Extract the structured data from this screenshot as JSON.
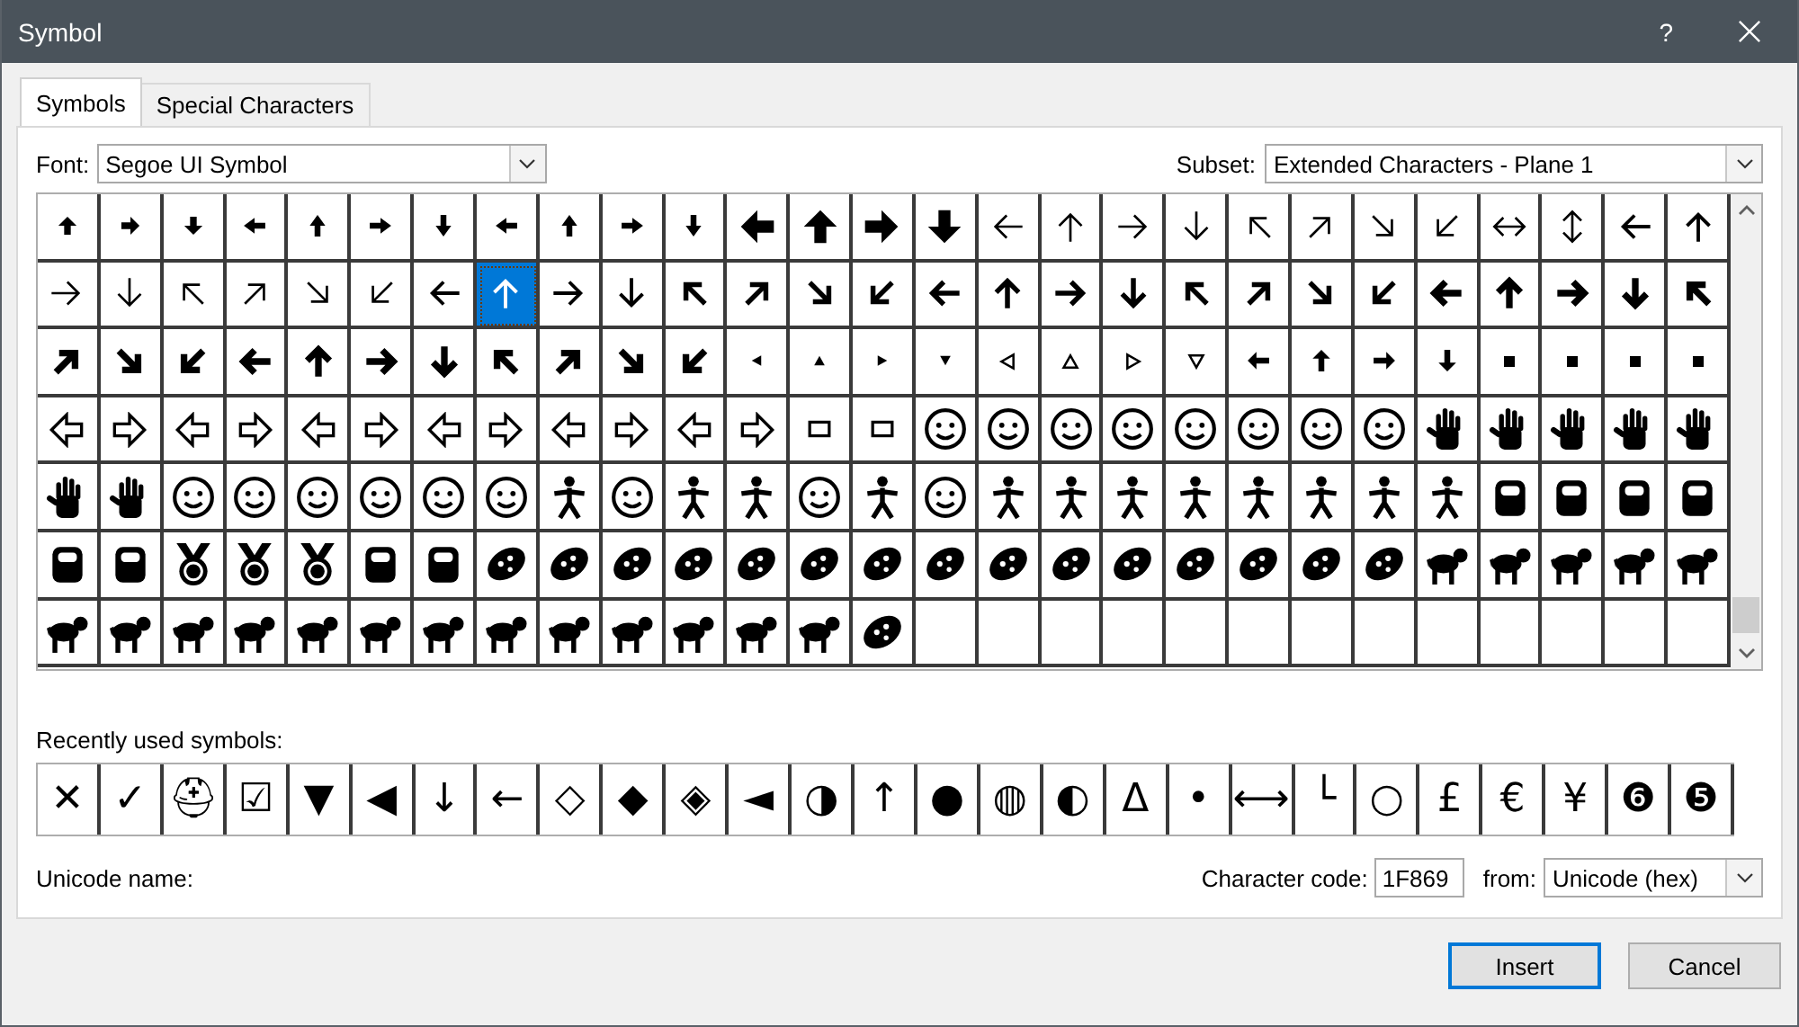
{
  "window": {
    "title": "Symbol",
    "help": "?"
  },
  "tabs": [
    {
      "label": "Symbols",
      "selected": true
    },
    {
      "label": "Special Characters",
      "selected": false
    }
  ],
  "font": {
    "label": "Font:",
    "value": "Segoe UI Symbol"
  },
  "subset": {
    "label": "Subset:",
    "value": "Extended Characters - Plane 1"
  },
  "grid": {
    "rows": [
      [
        {
          "kind": "smallUp",
          "selected": false
        },
        {
          "kind": "smallRight",
          "selected": false
        },
        {
          "kind": "smallDown",
          "selected": false
        },
        {
          "kind": "narrowLeft",
          "selected": false
        },
        {
          "kind": "narrowUp",
          "selected": false
        },
        {
          "kind": "narrowRight",
          "selected": false
        },
        {
          "kind": "narrowDown",
          "selected": false
        },
        {
          "kind": "narrowLeft",
          "selected": false
        },
        {
          "kind": "narrowUp",
          "selected": false
        },
        {
          "kind": "narrowRight",
          "selected": false
        },
        {
          "kind": "narrowDown",
          "selected": false
        },
        {
          "kind": "heavyLeft",
          "selected": false
        },
        {
          "kind": "heavyUp",
          "selected": false
        },
        {
          "kind": "heavyRight",
          "selected": false
        },
        {
          "kind": "heavyDown",
          "selected": false
        },
        {
          "kind": "thinLeft",
          "selected": false
        },
        {
          "kind": "thinUp",
          "selected": false
        },
        {
          "kind": "thinRight",
          "selected": false
        },
        {
          "kind": "thinDown",
          "selected": false
        },
        {
          "kind": "thinUpLeft",
          "selected": false
        },
        {
          "kind": "thinUpRight",
          "selected": false
        },
        {
          "kind": "thinDownRight",
          "selected": false
        },
        {
          "kind": "thinDownLeft",
          "selected": false
        },
        {
          "kind": "thinLeftRight",
          "selected": false
        },
        {
          "kind": "thinUpDown",
          "selected": false
        },
        {
          "kind": "mediumLeft",
          "selected": false
        },
        {
          "kind": "mediumUp",
          "selected": false
        }
      ],
      [
        {
          "kind": "thinRight",
          "selected": false
        },
        {
          "kind": "thinDown",
          "selected": false
        },
        {
          "kind": "thinUpLeft",
          "selected": false
        },
        {
          "kind": "thinUpRight",
          "selected": false
        },
        {
          "kind": "thinDownRight",
          "selected": false
        },
        {
          "kind": "thinDownLeft",
          "selected": false
        },
        {
          "kind": "mediumLeft",
          "selected": false
        },
        {
          "kind": "mediumUp",
          "selected": true
        },
        {
          "kind": "mediumRight",
          "selected": false
        },
        {
          "kind": "mediumDown",
          "selected": false
        },
        {
          "kind": "boldUpLeft",
          "selected": false
        },
        {
          "kind": "boldUpRight",
          "selected": false
        },
        {
          "kind": "boldDownRight",
          "selected": false
        },
        {
          "kind": "boldDownLeft",
          "selected": false
        },
        {
          "kind": "boldLeft",
          "selected": false
        },
        {
          "kind": "boldUp",
          "selected": false
        },
        {
          "kind": "boldRight",
          "selected": false
        },
        {
          "kind": "boldDown",
          "selected": false
        },
        {
          "kind": "boldUpLeft",
          "selected": false
        },
        {
          "kind": "boldUpRight",
          "selected": false
        },
        {
          "kind": "boldDownRight",
          "selected": false
        },
        {
          "kind": "boldDownLeft",
          "selected": false
        },
        {
          "kind": "extraboldLeft",
          "selected": false
        },
        {
          "kind": "extraboldUp",
          "selected": false
        },
        {
          "kind": "extraboldRight",
          "selected": false
        },
        {
          "kind": "extraboldDown",
          "selected": false
        },
        {
          "kind": "extraboldUpLeft",
          "selected": false
        }
      ],
      [
        {
          "kind": "extraboldUpRight",
          "selected": false
        },
        {
          "kind": "extraboldDownRight",
          "selected": false
        },
        {
          "kind": "extraboldDownLeft",
          "selected": false
        },
        {
          "kind": "extraboldLeft",
          "selected": false
        },
        {
          "kind": "extraboldUp",
          "selected": false
        },
        {
          "kind": "extraboldRight",
          "selected": false
        },
        {
          "kind": "extraboldDown",
          "selected": false
        },
        {
          "kind": "extraboldUpLeft",
          "selected": false
        },
        {
          "kind": "extraboldUpRight",
          "selected": false
        },
        {
          "kind": "extraboldDownRight",
          "selected": false
        },
        {
          "kind": "extraboldDownLeft",
          "selected": false
        },
        {
          "kind": "tinyLeft",
          "selected": false
        },
        {
          "kind": "tinyUp",
          "selected": false
        },
        {
          "kind": "tinyRight",
          "selected": false
        },
        {
          "kind": "tinyDown",
          "selected": false
        },
        {
          "kind": "hollowLeft",
          "selected": false
        },
        {
          "kind": "hollowUp",
          "selected": false
        },
        {
          "kind": "hollowRight",
          "selected": false
        },
        {
          "kind": "hollowDown",
          "selected": false
        },
        {
          "kind": "stubLeft",
          "selected": false
        },
        {
          "kind": "stubUp",
          "selected": false
        },
        {
          "kind": "stubRight",
          "selected": false
        },
        {
          "kind": "stubDown",
          "selected": false
        },
        {
          "kind": "dot",
          "selected": false
        },
        {
          "kind": "dot",
          "selected": false
        },
        {
          "kind": "dot",
          "selected": false
        },
        {
          "kind": "dot",
          "selected": false
        }
      ],
      [
        {
          "kind": "outlineLeft",
          "selected": false
        },
        {
          "kind": "outlineRight",
          "selected": false
        },
        {
          "kind": "outlineLeft",
          "selected": false
        },
        {
          "kind": "outlineRight",
          "selected": false
        },
        {
          "kind": "outlineLeft",
          "selected": false
        },
        {
          "kind": "outlineRight",
          "selected": false
        },
        {
          "kind": "outlineLeft",
          "selected": false
        },
        {
          "kind": "outlineRight",
          "selected": false
        },
        {
          "kind": "outlineLeft",
          "selected": false
        },
        {
          "kind": "outlineRight",
          "selected": false
        },
        {
          "kind": "outlineLeft",
          "selected": false
        },
        {
          "kind": "outlineRight",
          "selected": false
        },
        {
          "kind": "box",
          "selected": false
        },
        {
          "kind": "box",
          "selected": false
        },
        {
          "kind": "face",
          "selected": false
        },
        {
          "kind": "face",
          "selected": false
        },
        {
          "kind": "face",
          "selected": false
        },
        {
          "kind": "face",
          "selected": false
        },
        {
          "kind": "face",
          "selected": false
        },
        {
          "kind": "face",
          "selected": false
        },
        {
          "kind": "face",
          "selected": false
        },
        {
          "kind": "face",
          "selected": false
        },
        {
          "kind": "hand",
          "selected": false
        },
        {
          "kind": "hand",
          "selected": false
        },
        {
          "kind": "hand",
          "selected": false
        },
        {
          "kind": "hand",
          "selected": false
        },
        {
          "kind": "hand",
          "selected": false
        }
      ],
      [
        {
          "kind": "hand",
          "selected": false
        },
        {
          "kind": "hand",
          "selected": false
        },
        {
          "kind": "face",
          "selected": false
        },
        {
          "kind": "face",
          "selected": false
        },
        {
          "kind": "face",
          "selected": false
        },
        {
          "kind": "face",
          "selected": false
        },
        {
          "kind": "face",
          "selected": false
        },
        {
          "kind": "face",
          "selected": false
        },
        {
          "kind": "figure",
          "selected": false
        },
        {
          "kind": "face",
          "selected": false
        },
        {
          "kind": "figure",
          "selected": false
        },
        {
          "kind": "figure",
          "selected": false
        },
        {
          "kind": "face",
          "selected": false
        },
        {
          "kind": "figure",
          "selected": false
        },
        {
          "kind": "face",
          "selected": false
        },
        {
          "kind": "figure",
          "selected": false
        },
        {
          "kind": "figure",
          "selected": false
        },
        {
          "kind": "figure",
          "selected": false
        },
        {
          "kind": "figure",
          "selected": false
        },
        {
          "kind": "figure",
          "selected": false
        },
        {
          "kind": "figure",
          "selected": false
        },
        {
          "kind": "figure",
          "selected": false
        },
        {
          "kind": "figure",
          "selected": false
        },
        {
          "kind": "item",
          "selected": false
        },
        {
          "kind": "item",
          "selected": false
        },
        {
          "kind": "item",
          "selected": false
        },
        {
          "kind": "item",
          "selected": false
        }
      ],
      [
        {
          "kind": "item",
          "selected": false
        },
        {
          "kind": "item",
          "selected": false
        },
        {
          "kind": "medal",
          "selected": false
        },
        {
          "kind": "medal",
          "selected": false
        },
        {
          "kind": "medal",
          "selected": false
        },
        {
          "kind": "item",
          "selected": false
        },
        {
          "kind": "item",
          "selected": false
        },
        {
          "kind": "food",
          "selected": false
        },
        {
          "kind": "food",
          "selected": false
        },
        {
          "kind": "food",
          "selected": false
        },
        {
          "kind": "food",
          "selected": false
        },
        {
          "kind": "food",
          "selected": false
        },
        {
          "kind": "food",
          "selected": false
        },
        {
          "kind": "food",
          "selected": false
        },
        {
          "kind": "food",
          "selected": false
        },
        {
          "kind": "food",
          "selected": false
        },
        {
          "kind": "food",
          "selected": false
        },
        {
          "kind": "food",
          "selected": false
        },
        {
          "kind": "food",
          "selected": false
        },
        {
          "kind": "food",
          "selected": false
        },
        {
          "kind": "food",
          "selected": false
        },
        {
          "kind": "food",
          "selected": false
        },
        {
          "kind": "animal",
          "selected": false
        },
        {
          "kind": "animal",
          "selected": false
        },
        {
          "kind": "animal",
          "selected": false
        },
        {
          "kind": "animal",
          "selected": false
        },
        {
          "kind": "animal",
          "selected": false
        }
      ],
      [
        {
          "kind": "animal",
          "selected": false
        },
        {
          "kind": "animal",
          "selected": false
        },
        {
          "kind": "animal",
          "selected": false
        },
        {
          "kind": "animal",
          "selected": false
        },
        {
          "kind": "animal",
          "selected": false
        },
        {
          "kind": "animal",
          "selected": false
        },
        {
          "kind": "animal",
          "selected": false
        },
        {
          "kind": "animal",
          "selected": false
        },
        {
          "kind": "animal",
          "selected": false
        },
        {
          "kind": "animal",
          "selected": false
        },
        {
          "kind": "animal",
          "selected": false
        },
        {
          "kind": "animal",
          "selected": false
        },
        {
          "kind": "animal",
          "selected": false
        },
        {
          "kind": "food",
          "selected": false
        },
        {
          "kind": "empty",
          "selected": false
        },
        {
          "kind": "empty",
          "selected": false
        },
        {
          "kind": "empty",
          "selected": false
        },
        {
          "kind": "empty",
          "selected": false
        },
        {
          "kind": "empty",
          "selected": false
        },
        {
          "kind": "empty",
          "selected": false
        },
        {
          "kind": "empty",
          "selected": false
        },
        {
          "kind": "empty",
          "selected": false
        },
        {
          "kind": "empty",
          "selected": false
        },
        {
          "kind": "empty",
          "selected": false
        },
        {
          "kind": "empty",
          "selected": false
        },
        {
          "kind": "empty",
          "selected": false
        },
        {
          "kind": "empty",
          "selected": false
        }
      ]
    ]
  },
  "recent": {
    "label": "Recently used symbols:",
    "symbols": [
      "✕",
      "✓",
      "⛑",
      "☑",
      "▼",
      "◀",
      "↓",
      "←",
      "◇",
      "◆",
      "◈",
      "◄",
      "◑",
      "↑",
      "●",
      "◍",
      "◐",
      "Δ",
      "•",
      "⟷",
      "└",
      "○",
      "£",
      "€",
      "¥",
      "❻",
      "❺"
    ]
  },
  "unicode_name": {
    "label": "Unicode name:"
  },
  "character_code": {
    "label": "Character code:",
    "value": "1F869"
  },
  "from": {
    "label": "from:",
    "value": "Unicode (hex)"
  },
  "buttons": [
    {
      "label": "Insert",
      "default": true
    },
    {
      "label": "Cancel",
      "default": false
    }
  ]
}
